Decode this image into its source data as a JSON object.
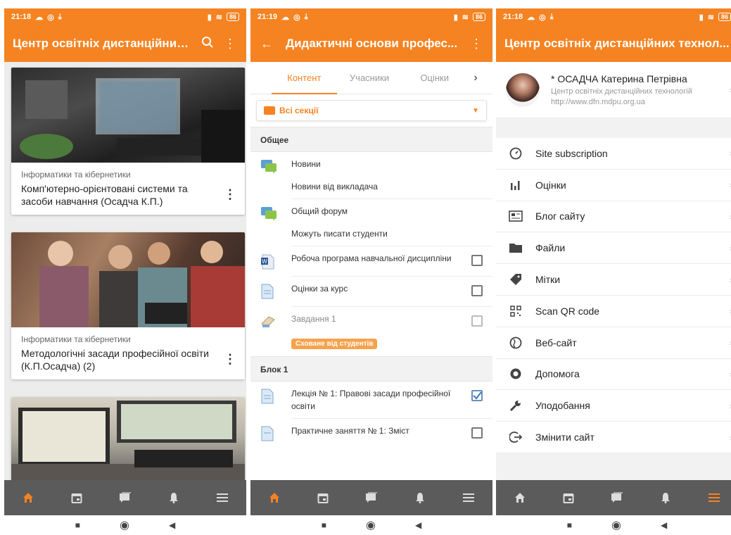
{
  "colors": {
    "accent": "#f58322",
    "nav_bg": "#5b5b5b"
  },
  "panel1": {
    "status_time": "21:18",
    "battery": "86",
    "title": "Центр освітніх дистанційних ...",
    "courses": [
      {
        "category": "Інформатики та кібернетики",
        "name": "Комп'ютерно-орієнтовані системи та засоби навчання (Осадча К.П.)"
      },
      {
        "category": "Інформатики та кібернетики",
        "name": "Методологічні засади професійної освіти (К.П.Осадча) (2)"
      }
    ]
  },
  "panel2": {
    "status_time": "21:19",
    "battery": "86",
    "title": "Дидактичні основи профес...",
    "tabs": [
      "Контент",
      "Учасники",
      "Оцінки"
    ],
    "section_select": "Всі секції",
    "sections": [
      {
        "name": "Общее",
        "modules": [
          {
            "name": "Новини",
            "sub": "Новини від викладача",
            "icon": "forum-icon",
            "checkbox": false
          },
          {
            "name": "Общий форум",
            "sub": "Можуть писати студенти",
            "icon": "forum-icon",
            "checkbox": false
          },
          {
            "name": "Робоча програма навчальної дисципліни",
            "sub": "",
            "icon": "word-doc-icon",
            "checkbox": true,
            "checked": false
          },
          {
            "name": "Оцінки за курс",
            "sub": "",
            "icon": "page-icon",
            "checkbox": true,
            "checked": false
          },
          {
            "name": "Завдання 1",
            "sub": "",
            "icon": "assignment-icon",
            "checkbox": true,
            "checked": false,
            "badge": "Сховане від студентів"
          }
        ]
      },
      {
        "name": "Блок 1",
        "modules": [
          {
            "name": "Лекція № 1: Правові засади професійної освіти",
            "sub": "",
            "icon": "page-icon",
            "checkbox": true,
            "checked": true
          },
          {
            "name": "Практичне заняття № 1: Зміст",
            "sub": "",
            "icon": "page-icon",
            "checkbox": true,
            "checked": false
          }
        ]
      }
    ]
  },
  "panel3": {
    "status_time": "21:18",
    "battery": "86",
    "title": "Центр освітніх дистанційних технол...",
    "profile": {
      "name": "* ОСАДЧА Катерина Петрівна",
      "site": "Центр освітніх дистанційних технологій",
      "url": "http://www.dfn.mdpu.org.ua"
    },
    "menu": [
      {
        "label": "Site subscription",
        "icon": "gauge-icon"
      },
      {
        "label": "Оцінки",
        "icon": "bar-chart-icon"
      },
      {
        "label": "Блог сайту",
        "icon": "newspaper-icon"
      },
      {
        "label": "Файли",
        "icon": "folder-icon"
      },
      {
        "label": "Мітки",
        "icon": "tag-icon"
      },
      {
        "label": "Scan QR code",
        "icon": "qr-code-icon"
      },
      {
        "label": "Веб-сайт",
        "icon": "globe-icon"
      },
      {
        "label": "Допомога",
        "icon": "lifebuoy-icon"
      },
      {
        "label": "Уподобання",
        "icon": "wrench-icon"
      },
      {
        "label": "Змінити сайт",
        "icon": "logout-icon"
      }
    ]
  }
}
